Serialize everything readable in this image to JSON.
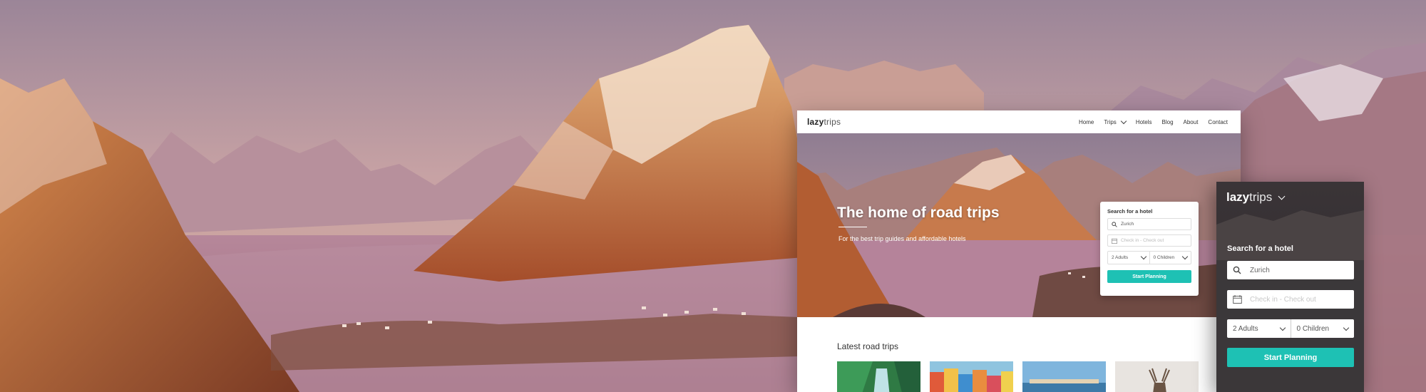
{
  "brand": {
    "bold": "lazy",
    "light": "trips"
  },
  "desktop_nav": {
    "items": [
      {
        "label": "Home"
      },
      {
        "label": "Trips"
      },
      {
        "label": "Hotels"
      },
      {
        "label": "Blog"
      },
      {
        "label": "About"
      },
      {
        "label": "Contact"
      }
    ]
  },
  "hero": {
    "title": "The home of road trips",
    "subtitle": "For the best trip guides and affordable hotels"
  },
  "search": {
    "title": "Search for a hotel",
    "location_value": "Zurich",
    "dates_placeholder": "Check in - Check out",
    "adults": "2 Adults",
    "children": "0 Children",
    "button": "Start Planning"
  },
  "latest": {
    "heading": "Latest road trips"
  },
  "colors": {
    "accent": "#1ec1b4",
    "dark": "#3a3638"
  },
  "icons": [
    "search-icon",
    "calendar-icon",
    "chevron-down-icon"
  ]
}
